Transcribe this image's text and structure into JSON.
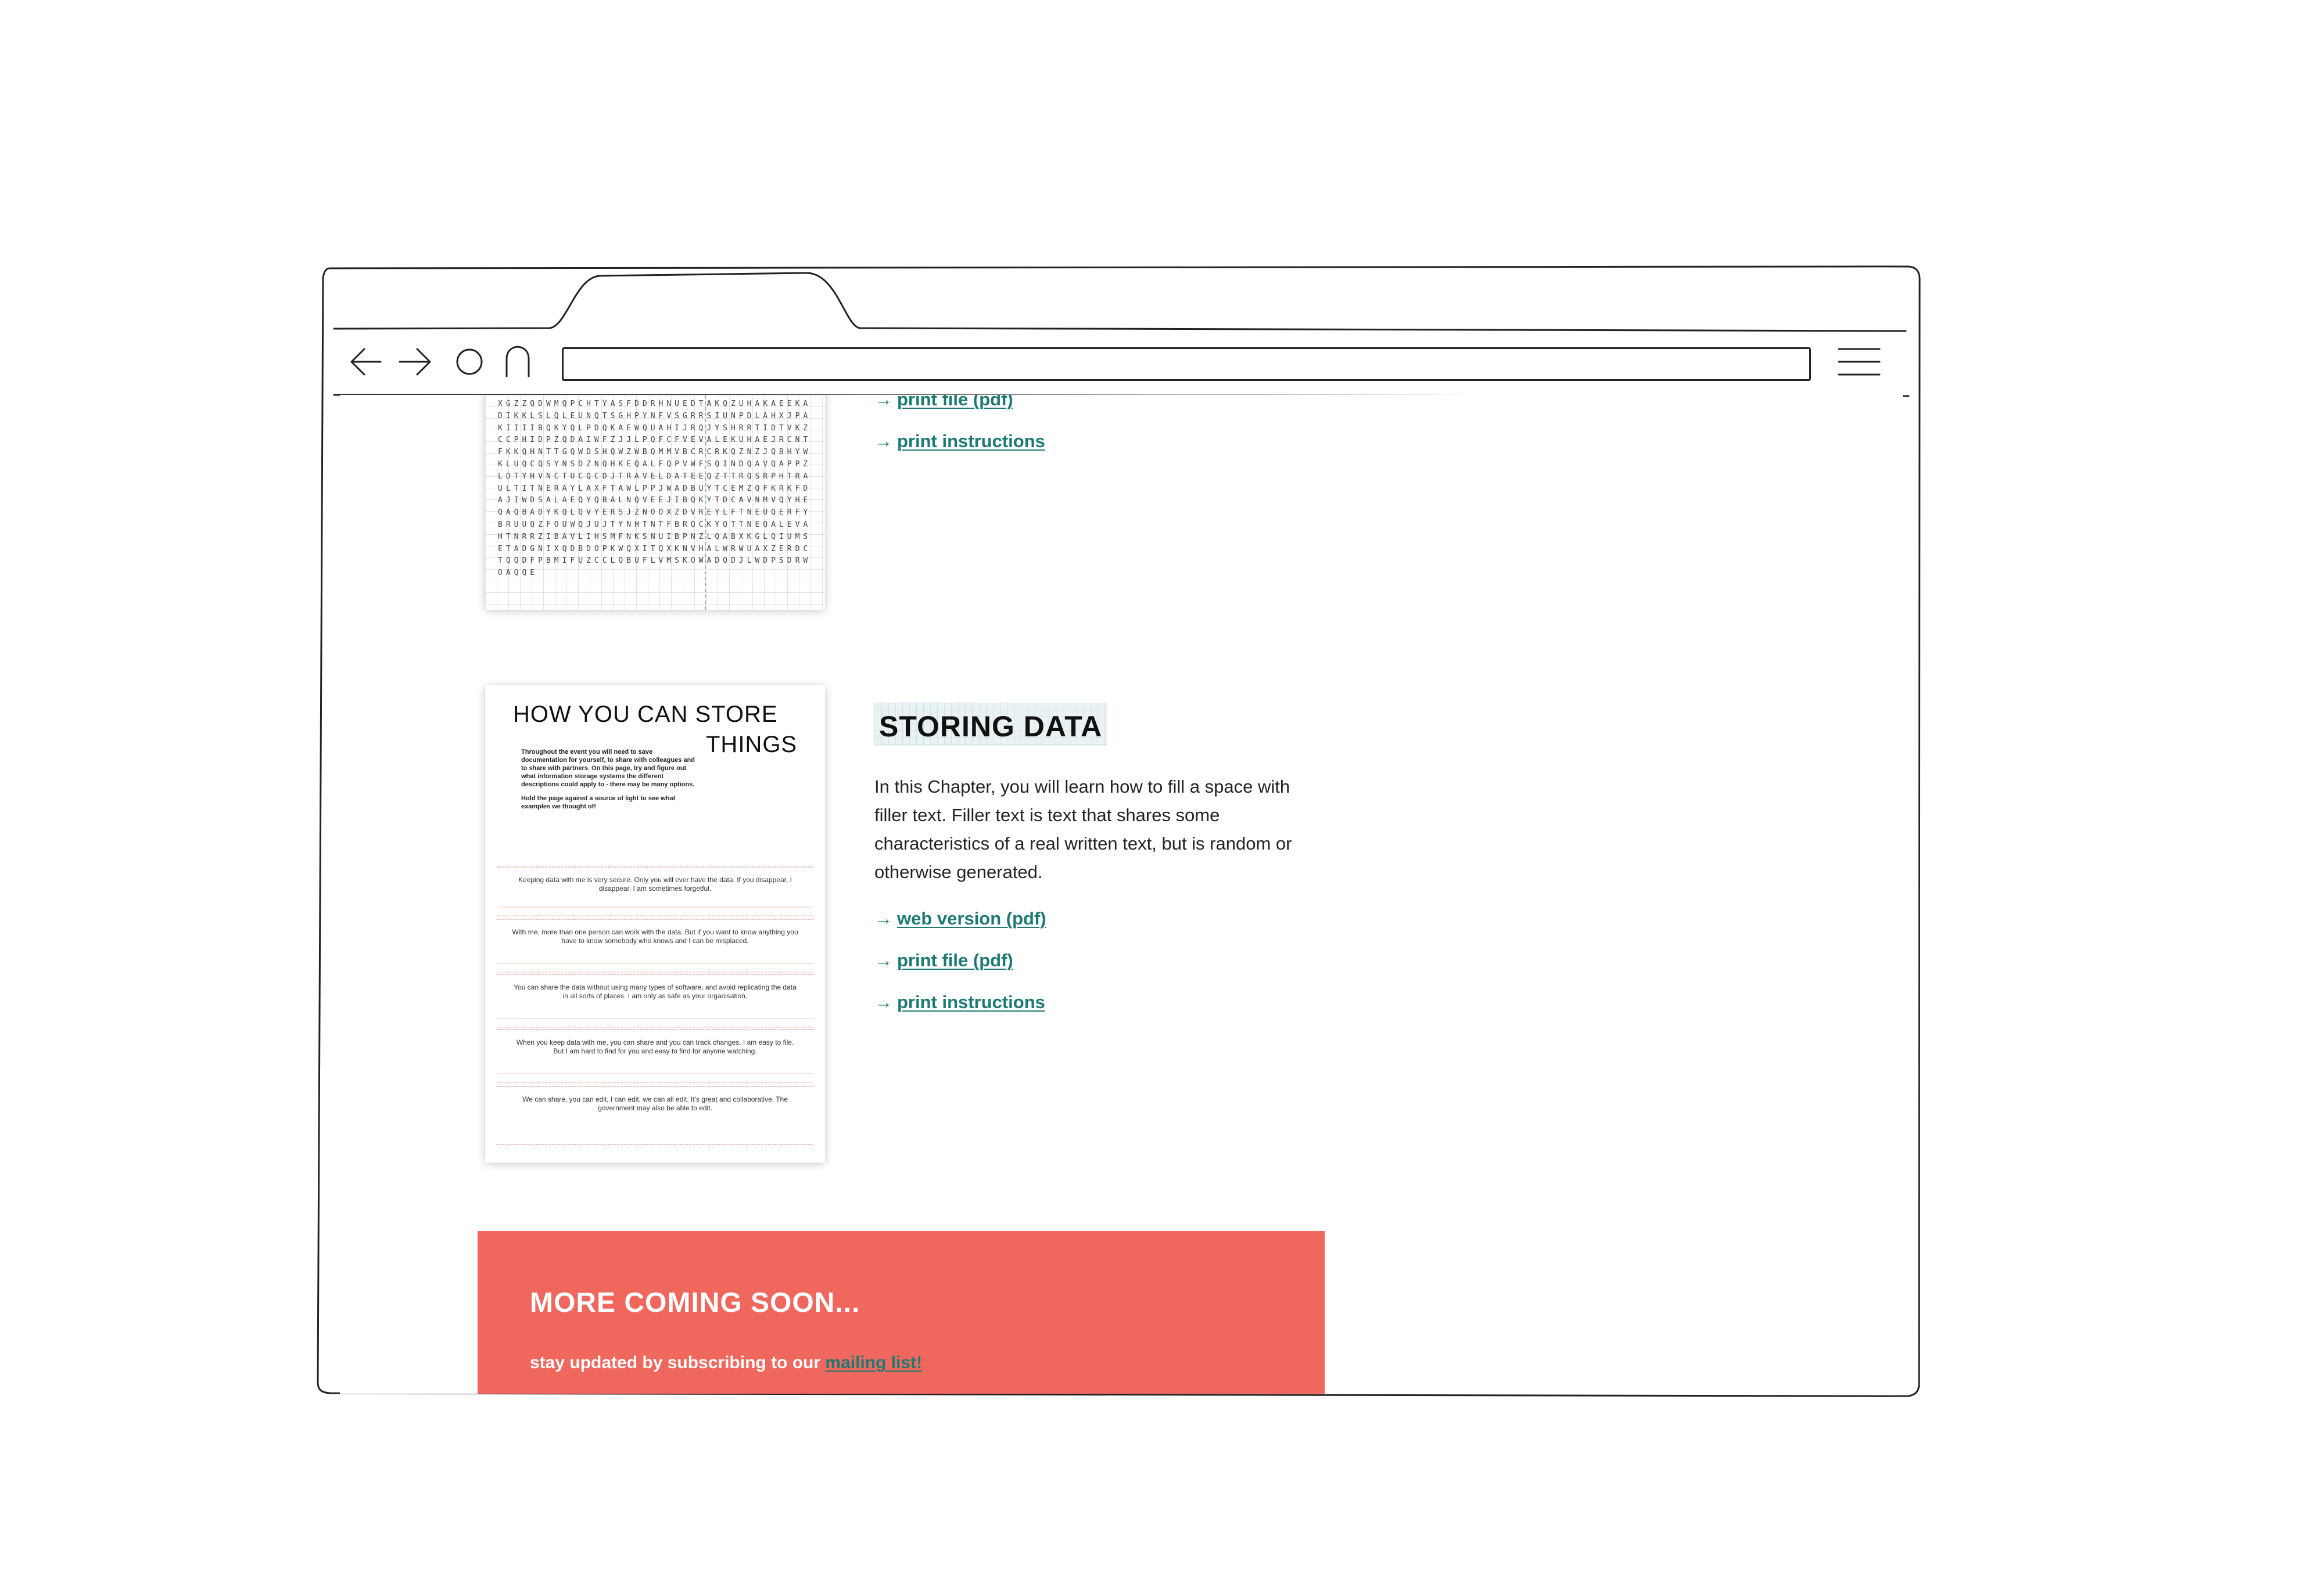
{
  "browser": {
    "address_bar": {
      "value": ""
    }
  },
  "chapter_prev": {
    "thumbnail_letters": "XGZZQDWMQPCHTYASFDDRHNUEDTAKQZUHAKAEEKADIKKLSLQLEUNQTSGHPYNFVSGRRSIUNPDLAHXJPAKIIIIBQKYQLPDQKAEWQUAHIJRQJYSHRRTIDTVKZCCPHIDPZQDAIWFZJJLPQFCFVEVALEKUHAEJRCNTFKKQHNTTGQWDSHQWZWBQMMVBCRCRKQZNZJQBHYWKLUQCQSYNSDZNQHKEQALFQPVWFSQINDQAVQAPPZLDTYHVNCTUCQCDJTRAVELDATEEQZTTRQSRPHTRAULTITNERAYLAXFTAWLPPJWADBUYTCEMZQFKRKFDAJIWDSALAEQYQBALNQVEEJIBQKYTDCAVNMVQYHEQAQBADYKQLQVYERSJZNOOXZDVREYLFTNEUQERFYBRUUQZFOUWQJUJTYNHTNTFBRQCKYQTTNEQALEVAHTNRRZIBAVLIHSMFNKSNUIBPNZLQABXKGLQIUMSETADGNIXQDBDOPKWQXITQXKNVHALWRWUAXZERDCTQQDFPBMIFUZCCLQBUFLVMSKOWADQDJLWDPSDRWOAQQE",
    "links": [
      "print file (pdf)",
      "print instructions"
    ]
  },
  "chapter_storing": {
    "thumbnail": {
      "title_line1": "HOW YOU CAN STORE",
      "title_line2": "THINGS",
      "intro_p1": "Throughout the event you will need to save documentation for yourself, to share with colleagues and to share with partners. On this page, try and figure out what information storage systems the different descriptions could apply to - there may be many options.",
      "intro_p2": "Hold the page against a source of light to see what examples we thought of!",
      "boxes": [
        "Keeping data with me is very secure. Only you will ever have the data. If you disappear, I disappear. I am sometimes forgetful.",
        "With me, more than one person can work with the data. But if you want to know anything you have to know somebody who knows and I can be misplaced.",
        "You can share the data without using many types of software, and avoid replicating the data in all sorts of places. I am only as safe as your organisation.",
        "When you keep data with me, you can share and you can track changes. I am easy to file. But I am hard to find for you and easy to find for anyone watching.",
        "We can share, you can edit, I can edit, we can all edit. It's great and collaborative. The government may also be able to edit."
      ]
    },
    "title": "STORING DATA",
    "description": "In this Chapter, you will learn how to fill a space with filler text. Filler text is text that shares some characteristics of a real written text, but is random or otherwise generated.",
    "links": [
      "web version (pdf)",
      "print file (pdf)",
      "print instructions"
    ]
  },
  "link_arrow": "→",
  "banner": {
    "title": "MORE COMING SOON...",
    "text": "stay updated by subscribing to our ",
    "link": "mailing list!",
    "color": "#f0675e"
  },
  "colors": {
    "link": "#1d7a73",
    "banner": "#f0675e"
  }
}
